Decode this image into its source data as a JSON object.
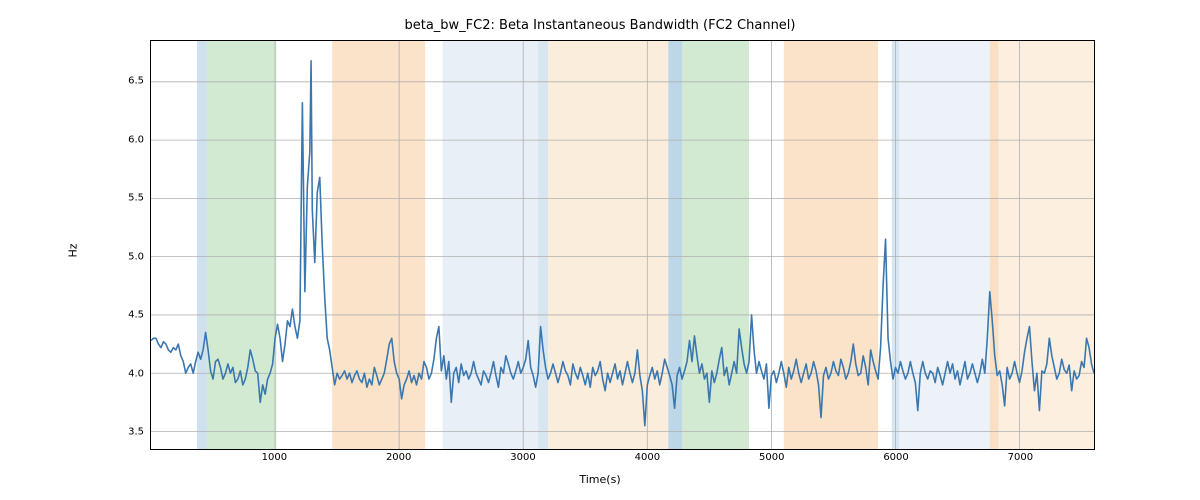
{
  "chart_data": {
    "type": "line",
    "title": "beta_bw_FC2: Beta Instantaneous Bandwidth (FC2 Channel)",
    "xlabel": "Time(s)",
    "ylabel": "Hz",
    "xlim": [
      0,
      7600
    ],
    "ylim": [
      3.35,
      6.85
    ],
    "xticks": [
      1000,
      2000,
      3000,
      4000,
      5000,
      6000,
      7000
    ],
    "yticks": [
      3.5,
      4.0,
      4.5,
      5.0,
      5.5,
      6.0,
      6.5
    ],
    "regions": [
      {
        "start": 370,
        "end": 450,
        "color": "#a8c8e0",
        "alpha": 0.55
      },
      {
        "start": 450,
        "end": 1010,
        "color": "#9cce9c",
        "alpha": 0.45
      },
      {
        "start": 1460,
        "end": 2210,
        "color": "#f5c088",
        "alpha": 0.45
      },
      {
        "start": 2350,
        "end": 3120,
        "color": "#bcd0e4",
        "alpha": 0.35
      },
      {
        "start": 3120,
        "end": 3200,
        "color": "#a8c8e0",
        "alpha": 0.45
      },
      {
        "start": 3200,
        "end": 4170,
        "color": "#f7d7b0",
        "alpha": 0.45
      },
      {
        "start": 4170,
        "end": 4280,
        "color": "#86b4d6",
        "alpha": 0.55
      },
      {
        "start": 4280,
        "end": 4820,
        "color": "#9cce9c",
        "alpha": 0.45
      },
      {
        "start": 5100,
        "end": 5860,
        "color": "#f5c088",
        "alpha": 0.45
      },
      {
        "start": 5970,
        "end": 6030,
        "color": "#a8c8e0",
        "alpha": 0.45
      },
      {
        "start": 6030,
        "end": 6760,
        "color": "#c9d9ea",
        "alpha": 0.35
      },
      {
        "start": 6760,
        "end": 6830,
        "color": "#f5c088",
        "alpha": 0.5
      },
      {
        "start": 6830,
        "end": 7600,
        "color": "#f7d7b0",
        "alpha": 0.4
      }
    ],
    "x": [
      0,
      20,
      40,
      60,
      80,
      100,
      120,
      140,
      160,
      180,
      200,
      220,
      240,
      260,
      280,
      300,
      320,
      340,
      360,
      380,
      400,
      420,
      440,
      460,
      480,
      500,
      520,
      540,
      560,
      580,
      600,
      620,
      640,
      660,
      680,
      700,
      720,
      740,
      760,
      780,
      800,
      820,
      840,
      860,
      880,
      900,
      920,
      940,
      960,
      980,
      1000,
      1020,
      1040,
      1060,
      1080,
      1100,
      1120,
      1140,
      1160,
      1180,
      1200,
      1220,
      1240,
      1260,
      1280,
      1290,
      1300,
      1320,
      1340,
      1360,
      1380,
      1400,
      1420,
      1440,
      1460,
      1480,
      1500,
      1520,
      1540,
      1560,
      1580,
      1600,
      1620,
      1640,
      1660,
      1680,
      1700,
      1720,
      1740,
      1760,
      1780,
      1800,
      1820,
      1840,
      1860,
      1880,
      1900,
      1920,
      1940,
      1960,
      1980,
      2000,
      2020,
      2040,
      2060,
      2080,
      2100,
      2120,
      2140,
      2160,
      2180,
      2200,
      2220,
      2240,
      2260,
      2280,
      2300,
      2320,
      2340,
      2360,
      2380,
      2400,
      2420,
      2440,
      2460,
      2480,
      2500,
      2520,
      2540,
      2560,
      2580,
      2600,
      2620,
      2640,
      2660,
      2680,
      2700,
      2720,
      2740,
      2760,
      2780,
      2800,
      2820,
      2840,
      2860,
      2880,
      2900,
      2920,
      2940,
      2960,
      2980,
      3000,
      3020,
      3040,
      3060,
      3080,
      3100,
      3120,
      3140,
      3160,
      3180,
      3200,
      3220,
      3240,
      3260,
      3280,
      3300,
      3320,
      3340,
      3360,
      3380,
      3400,
      3420,
      3440,
      3460,
      3480,
      3500,
      3520,
      3540,
      3560,
      3580,
      3600,
      3620,
      3640,
      3660,
      3680,
      3700,
      3720,
      3740,
      3760,
      3780,
      3800,
      3820,
      3840,
      3860,
      3880,
      3900,
      3920,
      3940,
      3960,
      3980,
      4000,
      4020,
      4040,
      4060,
      4080,
      4100,
      4120,
      4140,
      4160,
      4180,
      4200,
      4220,
      4240,
      4260,
      4280,
      4300,
      4320,
      4340,
      4360,
      4380,
      4400,
      4420,
      4440,
      4460,
      4480,
      4500,
      4520,
      4540,
      4560,
      4580,
      4600,
      4620,
      4640,
      4660,
      4680,
      4700,
      4720,
      4740,
      4760,
      4780,
      4800,
      4820,
      4840,
      4860,
      4880,
      4900,
      4920,
      4940,
      4960,
      4980,
      5000,
      5020,
      5040,
      5060,
      5080,
      5100,
      5120,
      5140,
      5160,
      5180,
      5200,
      5220,
      5240,
      5260,
      5280,
      5300,
      5320,
      5340,
      5360,
      5380,
      5400,
      5420,
      5440,
      5460,
      5480,
      5500,
      5520,
      5540,
      5560,
      5580,
      5600,
      5620,
      5640,
      5660,
      5680,
      5700,
      5720,
      5740,
      5760,
      5780,
      5800,
      5820,
      5840,
      5860,
      5880,
      5900,
      5920,
      5940,
      5960,
      5980,
      6000,
      6020,
      6040,
      6060,
      6080,
      6100,
      6120,
      6140,
      6160,
      6180,
      6200,
      6220,
      6240,
      6260,
      6280,
      6300,
      6320,
      6340,
      6360,
      6380,
      6400,
      6420,
      6440,
      6460,
      6480,
      6500,
      6520,
      6540,
      6560,
      6580,
      6600,
      6620,
      6640,
      6660,
      6680,
      6700,
      6720,
      6740,
      6760,
      6780,
      6800,
      6820,
      6840,
      6860,
      6880,
      6900,
      6920,
      6940,
      6960,
      6980,
      7000,
      7020,
      7040,
      7060,
      7080,
      7100,
      7120,
      7140,
      7160,
      7180,
      7200,
      7220,
      7240,
      7260,
      7280,
      7300,
      7320,
      7340,
      7360,
      7380,
      7400,
      7420,
      7440,
      7460,
      7480,
      7500,
      7520,
      7540,
      7560,
      7580,
      7600
    ],
    "values": [
      4.28,
      4.3,
      4.3,
      4.25,
      4.22,
      4.27,
      4.25,
      4.2,
      4.18,
      4.22,
      4.2,
      4.25,
      4.15,
      4.1,
      4.0,
      4.05,
      4.08,
      4.0,
      4.1,
      4.18,
      4.12,
      4.2,
      4.35,
      4.2,
      4.02,
      3.95,
      4.1,
      4.12,
      4.05,
      3.95,
      4.0,
      4.08,
      4.0,
      4.05,
      3.92,
      3.95,
      4.02,
      3.9,
      3.95,
      4.05,
      4.2,
      4.12,
      4.02,
      4.0,
      3.75,
      3.9,
      3.82,
      3.95,
      4.0,
      4.08,
      4.3,
      4.42,
      4.3,
      4.1,
      4.25,
      4.45,
      4.4,
      4.55,
      4.4,
      4.3,
      4.45,
      6.32,
      4.7,
      5.6,
      5.9,
      6.68,
      5.4,
      4.95,
      5.55,
      5.68,
      5.1,
      4.65,
      4.3,
      4.2,
      4.05,
      3.9,
      4.0,
      3.95,
      3.98,
      4.02,
      3.95,
      4.0,
      3.92,
      3.98,
      4.02,
      3.95,
      3.92,
      4.0,
      3.88,
      3.95,
      3.9,
      4.05,
      3.98,
      3.9,
      3.95,
      4.0,
      4.12,
      4.25,
      4.3,
      4.1,
      4.0,
      3.95,
      3.78,
      3.9,
      3.95,
      4.02,
      3.92,
      3.98,
      3.9,
      4.0,
      3.95,
      4.1,
      4.05,
      3.95,
      4.0,
      4.12,
      4.3,
      4.4,
      4.02,
      4.15,
      3.95,
      4.1,
      3.75,
      4.0,
      4.05,
      3.92,
      4.08,
      3.98,
      4.02,
      3.95,
      4.0,
      4.1,
      4.0,
      3.95,
      3.9,
      4.02,
      3.98,
      3.92,
      4.0,
      4.1,
      3.98,
      3.88,
      4.05,
      4.0,
      4.15,
      4.08,
      4.0,
      3.95,
      4.02,
      4.1,
      4.0,
      4.05,
      4.12,
      4.28,
      4.05,
      3.98,
      3.88,
      4.0,
      4.4,
      4.2,
      4.05,
      3.95,
      4.0,
      4.08,
      4.0,
      3.92,
      4.0,
      4.1,
      4.02,
      3.98,
      3.9,
      4.08,
      4.0,
      3.95,
      4.05,
      3.98,
      3.9,
      4.0,
      3.88,
      4.05,
      3.98,
      4.02,
      4.1,
      3.95,
      3.85,
      4.0,
      3.92,
      4.0,
      4.08,
      3.95,
      4.02,
      3.9,
      4.0,
      4.1,
      4.0,
      3.92,
      4.0,
      4.2,
      3.98,
      3.85,
      3.55,
      3.9,
      3.98,
      4.05,
      3.95,
      4.02,
      3.9,
      4.0,
      4.12,
      4.05,
      3.98,
      3.9,
      3.7,
      3.98,
      4.05,
      3.95,
      4.02,
      4.1,
      4.28,
      4.1,
      4.32,
      4.15,
      4.0,
      4.08,
      3.95,
      4.0,
      3.75,
      4.02,
      3.92,
      4.0,
      4.12,
      4.22,
      3.98,
      4.05,
      3.9,
      4.0,
      4.1,
      4.0,
      4.38,
      4.22,
      4.08,
      4.0,
      4.1,
      4.5,
      4.2,
      4.0,
      4.1,
      4.02,
      3.95,
      4.08,
      3.7,
      3.98,
      4.02,
      3.92,
      4.0,
      4.1,
      4.0,
      3.88,
      4.05,
      3.95,
      4.02,
      4.12,
      4.0,
      3.92,
      4.0,
      4.08,
      3.95,
      4.0,
      4.1,
      4.02,
      3.9,
      3.62,
      3.98,
      4.05,
      3.95,
      4.0,
      4.1,
      4.02,
      3.98,
      4.12,
      4.05,
      3.95,
      4.0,
      4.1,
      4.25,
      4.08,
      3.98,
      4.0,
      4.15,
      4.05,
      3.9,
      4.2,
      4.1,
      4.02,
      3.95,
      4.22,
      4.75,
      5.15,
      4.3,
      4.1,
      3.95,
      4.05,
      4.0,
      4.1,
      4.02,
      3.95,
      4.0,
      4.1,
      4.0,
      3.92,
      3.68,
      4.0,
      4.1,
      4.0,
      3.95,
      4.02,
      4.0,
      3.92,
      4.05,
      3.98,
      3.9,
      4.0,
      4.1,
      4.0,
      4.08,
      3.95,
      4.02,
      3.9,
      4.0,
      4.1,
      3.95,
      4.0,
      4.08,
      4.0,
      3.92,
      4.0,
      4.12,
      4.0,
      4.3,
      4.7,
      4.45,
      4.15,
      3.98,
      4.02,
      3.9,
      3.72,
      4.05,
      3.95,
      4.0,
      4.1,
      4.0,
      3.92,
      4.02,
      4.18,
      4.3,
      4.4,
      4.1,
      3.85,
      4.0,
      3.68,
      4.02,
      4.0,
      4.08,
      4.3,
      4.15,
      4.05,
      3.95,
      4.0,
      4.12,
      4.03,
      4.0,
      4.07,
      3.85,
      4.02,
      3.95,
      3.98,
      4.1,
      4.05,
      4.3,
      4.22,
      4.08,
      4.0,
      4.1,
      4.12,
      4.1,
      4.1
    ],
    "line_color": "#3b77af"
  }
}
